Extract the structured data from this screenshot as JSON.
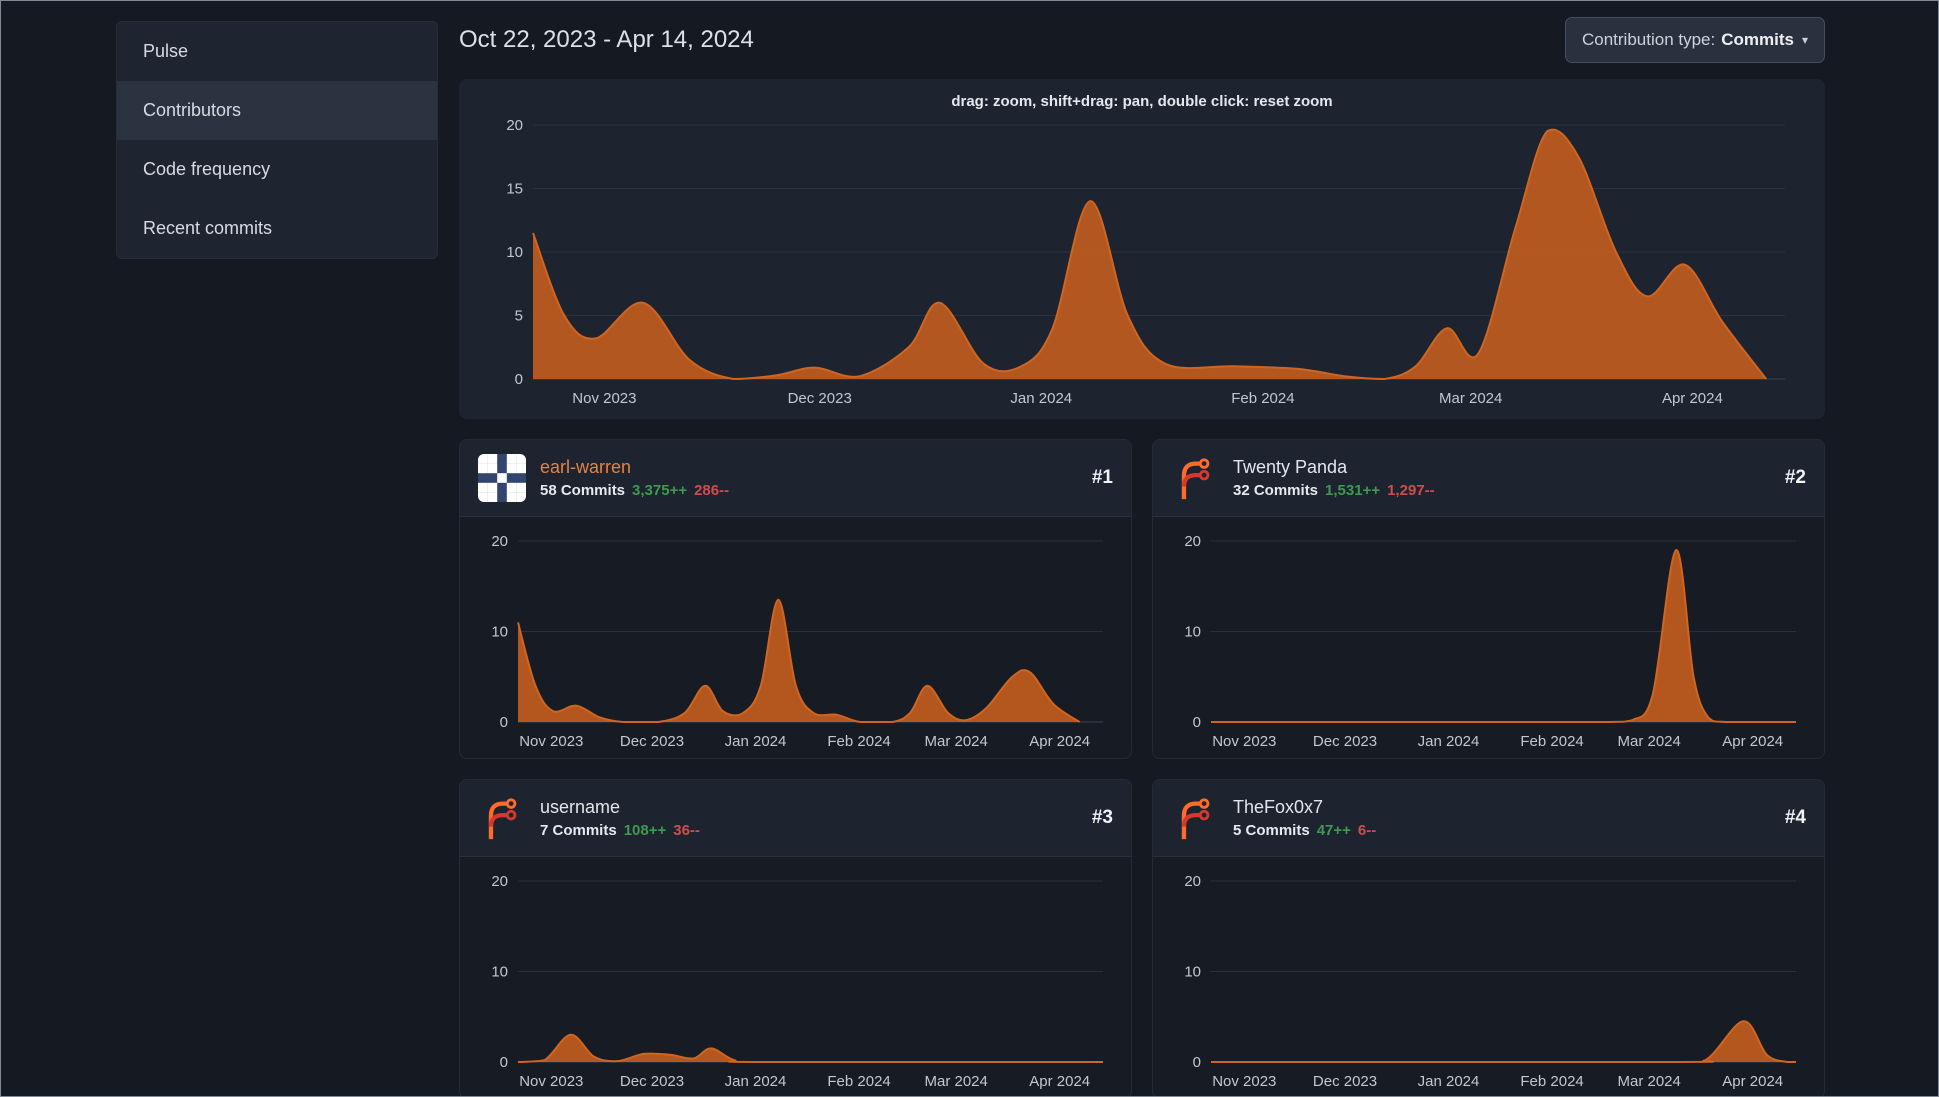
{
  "theme": {
    "chart_fill": "#bc5b20",
    "chart_line": "#cf6520",
    "link_orange": "#e58244",
    "additions_green": "#3d9a50",
    "deletions_red": "#cf4d4d"
  },
  "sidebar": {
    "items": [
      {
        "label": "Pulse",
        "active": false
      },
      {
        "label": "Contributors",
        "active": true
      },
      {
        "label": "Code frequency",
        "active": false
      },
      {
        "label": "Recent commits",
        "active": false
      }
    ]
  },
  "header": {
    "date_range": "Oct 22, 2023 - Apr 14, 2024",
    "contribution_type": {
      "label": "Contribution type:",
      "value": "Commits",
      "caret": "▾"
    }
  },
  "main_chart_hint": "drag: zoom, shift+drag: pan, double click: reset zoom",
  "contributors": [
    {
      "name": "earl-warren",
      "rank": "#1",
      "commits": "58 Commits",
      "additions": "3,375++",
      "deletions": "286--",
      "avatar_type": "identicon",
      "avatar_bg": "#31456f",
      "avatar_fg": "#ffffff",
      "avatar_grid": [
        [
          1,
          1,
          0,
          1,
          1
        ],
        [
          1,
          1,
          0,
          1,
          1
        ],
        [
          0,
          0,
          1,
          0,
          0
        ],
        [
          1,
          1,
          0,
          1,
          1
        ],
        [
          1,
          1,
          0,
          1,
          1
        ]
      ]
    },
    {
      "name": "Twenty Panda",
      "rank": "#2",
      "commits": "32 Commits",
      "additions": "1,531++",
      "deletions": "1,297--",
      "avatar_type": "forgejo-logo"
    },
    {
      "name": "username",
      "rank": "#3",
      "commits": "7 Commits",
      "additions": "108++",
      "deletions": "36--",
      "avatar_type": "forgejo-logo"
    },
    {
      "name": "TheFox0x7",
      "rank": "#4",
      "commits": "5 Commits",
      "additions": "47++",
      "deletions": "6--",
      "avatar_type": "forgejo-logo"
    }
  ],
  "chart_data": [
    {
      "id": "overall-commits",
      "type": "area",
      "title": "",
      "ylabel": "Commits",
      "ylim": [
        0,
        20
      ],
      "y_ticks": [
        0,
        5,
        10,
        15,
        20
      ],
      "x_ticks": [
        {
          "pos": 0.057,
          "label": "Nov 2023"
        },
        {
          "pos": 0.229,
          "label": "Dec 2023"
        },
        {
          "pos": 0.406,
          "label": "Jan 2024"
        },
        {
          "pos": 0.583,
          "label": "Feb 2024"
        },
        {
          "pos": 0.749,
          "label": "Mar 2024"
        },
        {
          "pos": 0.926,
          "label": "Apr 2024"
        }
      ],
      "points": [
        [
          0,
          11.5
        ],
        [
          0.025,
          5.0
        ],
        [
          0.05,
          3.2
        ],
        [
          0.088,
          6.0
        ],
        [
          0.125,
          1.5
        ],
        [
          0.16,
          0
        ],
        [
          0.195,
          0.3
        ],
        [
          0.225,
          0.9
        ],
        [
          0.26,
          0.2
        ],
        [
          0.3,
          2.5
        ],
        [
          0.325,
          6.0
        ],
        [
          0.36,
          1.2
        ],
        [
          0.39,
          1.0
        ],
        [
          0.415,
          4.0
        ],
        [
          0.445,
          14.0
        ],
        [
          0.475,
          5.0
        ],
        [
          0.505,
          1.2
        ],
        [
          0.56,
          1.0
        ],
        [
          0.61,
          0.8
        ],
        [
          0.65,
          0.2
        ],
        [
          0.68,
          0
        ],
        [
          0.705,
          1.0
        ],
        [
          0.73,
          4.0
        ],
        [
          0.755,
          2.0
        ],
        [
          0.785,
          12.0
        ],
        [
          0.81,
          19.5
        ],
        [
          0.835,
          17.5
        ],
        [
          0.865,
          10.0
        ],
        [
          0.89,
          6.5
        ],
        [
          0.92,
          9.0
        ],
        [
          0.95,
          4.5
        ],
        [
          0.985,
          0
        ]
      ]
    },
    {
      "id": "earl-warren-commits",
      "type": "area",
      "ylim": [
        0,
        20
      ],
      "y_ticks": [
        0,
        10,
        20
      ],
      "x_ticks": [
        {
          "pos": 0.057,
          "label": "Nov 2023"
        },
        {
          "pos": 0.229,
          "label": "Dec 2023"
        },
        {
          "pos": 0.406,
          "label": "Jan 2024"
        },
        {
          "pos": 0.583,
          "label": "Feb 2024"
        },
        {
          "pos": 0.749,
          "label": "Mar 2024"
        },
        {
          "pos": 0.926,
          "label": "Apr 2024"
        }
      ],
      "points": [
        [
          0,
          11.0
        ],
        [
          0.03,
          4.0
        ],
        [
          0.06,
          1.2
        ],
        [
          0.1,
          1.8
        ],
        [
          0.14,
          0.5
        ],
        [
          0.18,
          0
        ],
        [
          0.24,
          0
        ],
        [
          0.285,
          1.0
        ],
        [
          0.32,
          4.0
        ],
        [
          0.35,
          1.2
        ],
        [
          0.385,
          1.0
        ],
        [
          0.415,
          4.0
        ],
        [
          0.445,
          13.5
        ],
        [
          0.475,
          4.0
        ],
        [
          0.505,
          1.0
        ],
        [
          0.545,
          0.8
        ],
        [
          0.585,
          0
        ],
        [
          0.64,
          0
        ],
        [
          0.67,
          1.0
        ],
        [
          0.7,
          4.0
        ],
        [
          0.735,
          1.0
        ],
        [
          0.765,
          0.2
        ],
        [
          0.8,
          1.5
        ],
        [
          0.845,
          5.0
        ],
        [
          0.875,
          5.5
        ],
        [
          0.915,
          2.0
        ],
        [
          0.96,
          0
        ]
      ]
    },
    {
      "id": "twenty-panda-commits",
      "type": "area",
      "ylim": [
        0,
        20
      ],
      "y_ticks": [
        0,
        10,
        20
      ],
      "x_ticks": [
        {
          "pos": 0.057,
          "label": "Nov 2023"
        },
        {
          "pos": 0.229,
          "label": "Dec 2023"
        },
        {
          "pos": 0.406,
          "label": "Jan 2024"
        },
        {
          "pos": 0.583,
          "label": "Feb 2024"
        },
        {
          "pos": 0.749,
          "label": "Mar 2024"
        },
        {
          "pos": 0.926,
          "label": "Apr 2024"
        }
      ],
      "points": [
        [
          0,
          0
        ],
        [
          0.55,
          0
        ],
        [
          0.68,
          0
        ],
        [
          0.72,
          0.2
        ],
        [
          0.755,
          3.0
        ],
        [
          0.795,
          19.0
        ],
        [
          0.825,
          5.0
        ],
        [
          0.85,
          0.5
        ],
        [
          0.88,
          0
        ],
        [
          1,
          0
        ]
      ]
    },
    {
      "id": "username-commits",
      "type": "area",
      "ylim": [
        0,
        20
      ],
      "y_ticks": [
        0,
        10,
        20
      ],
      "x_ticks": [
        {
          "pos": 0.057,
          "label": "Nov 2023"
        },
        {
          "pos": 0.229,
          "label": "Dec 2023"
        },
        {
          "pos": 0.406,
          "label": "Jan 2024"
        },
        {
          "pos": 0.583,
          "label": "Feb 2024"
        },
        {
          "pos": 0.749,
          "label": "Mar 2024"
        },
        {
          "pos": 0.926,
          "label": "Apr 2024"
        }
      ],
      "points": [
        [
          0,
          0
        ],
        [
          0.045,
          0.2
        ],
        [
          0.09,
          3.0
        ],
        [
          0.13,
          0.6
        ],
        [
          0.17,
          0.1
        ],
        [
          0.215,
          0.9
        ],
        [
          0.26,
          0.8
        ],
        [
          0.3,
          0.4
        ],
        [
          0.33,
          1.5
        ],
        [
          0.37,
          0.2
        ],
        [
          0.42,
          0
        ],
        [
          1,
          0
        ]
      ]
    },
    {
      "id": "thefox0x7-commits",
      "type": "area",
      "ylim": [
        0,
        20
      ],
      "y_ticks": [
        0,
        10,
        20
      ],
      "x_ticks": [
        {
          "pos": 0.057,
          "label": "Nov 2023"
        },
        {
          "pos": 0.229,
          "label": "Dec 2023"
        },
        {
          "pos": 0.406,
          "label": "Jan 2024"
        },
        {
          "pos": 0.583,
          "label": "Feb 2024"
        },
        {
          "pos": 0.749,
          "label": "Mar 2024"
        },
        {
          "pos": 0.926,
          "label": "Apr 2024"
        }
      ],
      "points": [
        [
          0,
          0
        ],
        [
          0.78,
          0
        ],
        [
          0.845,
          0.2
        ],
        [
          0.91,
          4.5
        ],
        [
          0.95,
          0.8
        ],
        [
          0.985,
          0
        ],
        [
          1,
          0
        ]
      ]
    }
  ]
}
